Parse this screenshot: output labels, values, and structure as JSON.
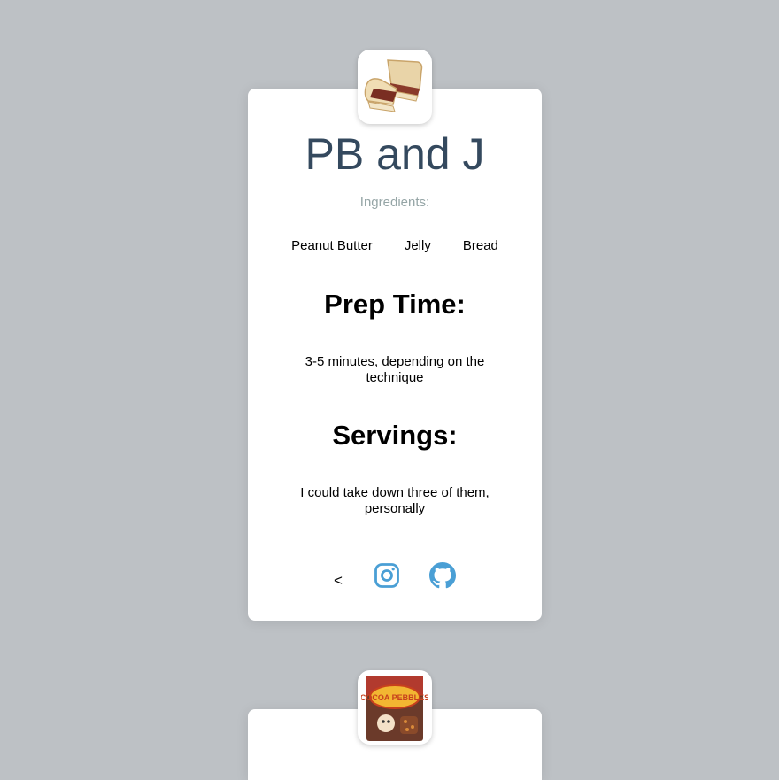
{
  "colors": {
    "background": "#bdc1c5",
    "card": "#ffffff",
    "title": "#34495e",
    "subtitle": "#95a5a6",
    "icon_accent": "#4a9fd5"
  },
  "recipes": [
    {
      "image_icon": "sandwich-image",
      "title": "PB and J",
      "ingredients_label": "Ingredients:",
      "ingredients": [
        "Peanut Butter",
        "Jelly",
        "Bread"
      ],
      "prep_heading": "Prep Time:",
      "prep_text": "3-5 minutes, depending on the technique",
      "servings_heading": "Servings:",
      "servings_text": "I could take down three of them, personally",
      "footer": {
        "back_label": "<",
        "instagram_icon": "instagram-icon",
        "github_icon": "github-icon"
      }
    },
    {
      "image_icon": "cereal-box-image",
      "cereal_logo_text": "COCOA PEBBLES"
    }
  ]
}
